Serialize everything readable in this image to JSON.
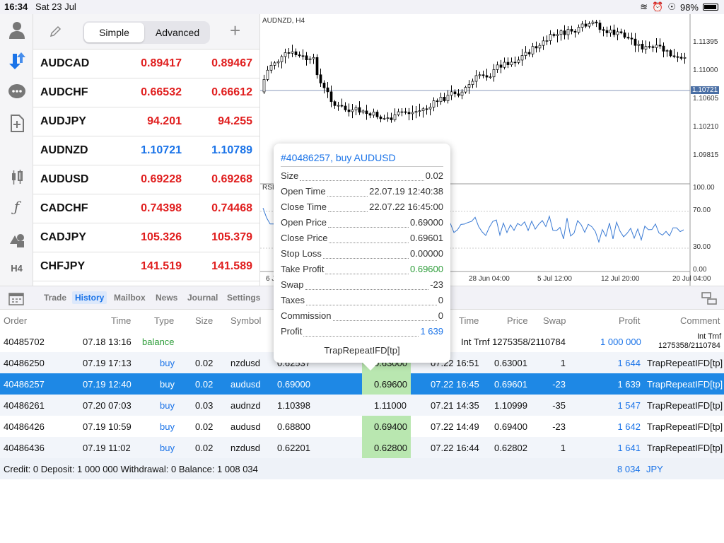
{
  "status": {
    "time": "16:34",
    "date": "Sat 23 Jul",
    "battery": "98%"
  },
  "sidebar": {
    "icons": [
      "account-icon",
      "quotes-icon",
      "chat-icon",
      "new-order-icon",
      "indicators-icon",
      "function-icon",
      "objects-icon",
      "timeframe-icon"
    ],
    "timeframe_label": "H4"
  },
  "quotes_panel": {
    "tab_simple": "Simple",
    "tab_advanced": "Advanced",
    "rows": [
      {
        "symbol": "AUDCAD",
        "bid": "0.89417",
        "ask": "0.89467",
        "color": "#e01e1e"
      },
      {
        "symbol": "AUDCHF",
        "bid": "0.66532",
        "ask": "0.66612",
        "color": "#e01e1e"
      },
      {
        "symbol": "AUDJPY",
        "bid": "94.201",
        "ask": "94.255",
        "color": "#e01e1e"
      },
      {
        "symbol": "AUDNZD",
        "bid": "1.10721",
        "ask": "1.10789",
        "color": "#1a73e8"
      },
      {
        "symbol": "AUDUSD",
        "bid": "0.69228",
        "ask": "0.69268",
        "color": "#e01e1e"
      },
      {
        "symbol": "CADCHF",
        "bid": "0.74398",
        "ask": "0.74468",
        "color": "#e01e1e"
      },
      {
        "symbol": "CADJPY",
        "bid": "105.326",
        "ask": "105.379",
        "color": "#e01e1e"
      },
      {
        "symbol": "CHFJPY",
        "bid": "141.519",
        "ask": "141.589",
        "color": "#e01e1e"
      }
    ]
  },
  "chart": {
    "symbol_label": "AUDNZD, H4",
    "rsi_label": "RSI",
    "price_ticks": [
      "1.11395",
      "1.11000",
      "1.10605",
      "1.10210",
      "1.09815"
    ],
    "current_price": "1.10721",
    "rsi_ticks": [
      "100.00",
      "70.00",
      "30.00",
      "0.00"
    ],
    "time_ticks": [
      "6 J",
      "28 Jun 04:00",
      "5 Jul 12:00",
      "12 Jul 20:00",
      "20 Jul 04:00"
    ]
  },
  "tabs": {
    "items": [
      "Trade",
      "History",
      "Mailbox",
      "News",
      "Journal",
      "Settings"
    ],
    "active": "History"
  },
  "history": {
    "headers": {
      "order": "Order",
      "time": "Time",
      "type": "Type",
      "size": "Size",
      "symbol": "Symbol",
      "close_time": "Time",
      "close_price": "Price",
      "swap": "Swap",
      "profit": "Profit",
      "comment": "Comment"
    },
    "balance_row": {
      "order": "40485702",
      "time": "07.18 13:16",
      "type": "balance",
      "info": "Int Trnf 1275358/2110784",
      "profit": "1 000 000",
      "comment_line1": "Int Trnf",
      "comment_line2": "1275358/2110784"
    },
    "rows": [
      {
        "order": "40486250",
        "time": "07.19 17:13",
        "type": "buy",
        "size": "0.02",
        "symbol": "nzdusd",
        "price": "0.62537",
        "tp": "0.63000",
        "close_time": "07.22 16:51",
        "close_price": "0.63001",
        "swap": "1",
        "profit": "1 644",
        "comment": "TrapRepeatIFD[tp]"
      },
      {
        "order": "40486257",
        "time": "07.19 12:40",
        "type": "buy",
        "size": "0.02",
        "symbol": "audusd",
        "price": "0.69000",
        "tp": "0.69600",
        "close_time": "07.22 16:45",
        "close_price": "0.69601",
        "swap": "-23",
        "profit": "1 639",
        "comment": "TrapRepeatIFD[tp]"
      },
      {
        "order": "40486261",
        "time": "07.20 07:03",
        "type": "buy",
        "size": "0.03",
        "symbol": "audnzd",
        "price": "1.10398",
        "tp": "1.11000",
        "close_time": "07.21 14:35",
        "close_price": "1.10999",
        "swap": "-35",
        "profit": "1 547",
        "comment": "TrapRepeatIFD[tp]"
      },
      {
        "order": "40486426",
        "time": "07.19 10:59",
        "type": "buy",
        "size": "0.02",
        "symbol": "audusd",
        "price": "0.68800",
        "tp": "0.69400",
        "close_time": "07.22 14:49",
        "close_price": "0.69400",
        "swap": "-23",
        "profit": "1 642",
        "comment": "TrapRepeatIFD[tp]"
      },
      {
        "order": "40486436",
        "time": "07.19 11:02",
        "type": "buy",
        "size": "0.02",
        "symbol": "nzdusd",
        "price": "0.62201",
        "tp": "0.62800",
        "close_time": "07.22 16:44",
        "close_price": "0.62802",
        "swap": "1",
        "profit": "1 641",
        "comment": "TrapRepeatIFD[tp]"
      }
    ],
    "footer": {
      "summary": "Credit: 0 Deposit: 1 000 000 Withdrawal: 0 Balance: 1 008 034",
      "total": "8 034",
      "currency": "JPY"
    }
  },
  "popup": {
    "title": "#40486257, buy AUDUSD",
    "rows": [
      {
        "label": "Size",
        "value": "0.02"
      },
      {
        "label": "Open Time",
        "value": "22.07.19 12:40:38"
      },
      {
        "label": "Close Time",
        "value": "22.07.22 16:45:00"
      },
      {
        "label": "Open Price",
        "value": "0.69000"
      },
      {
        "label": "Close Price",
        "value": "0.69601"
      },
      {
        "label": "Stop Loss",
        "value": "0.00000"
      },
      {
        "label": "Take Profit",
        "value": "0.69600"
      },
      {
        "label": "Swap",
        "value": "-23"
      },
      {
        "label": "Taxes",
        "value": "0"
      },
      {
        "label": "Commission",
        "value": "0"
      },
      {
        "label": "Profit",
        "value": "1 639"
      }
    ],
    "comment": "TrapRepeatIFD[tp]"
  }
}
